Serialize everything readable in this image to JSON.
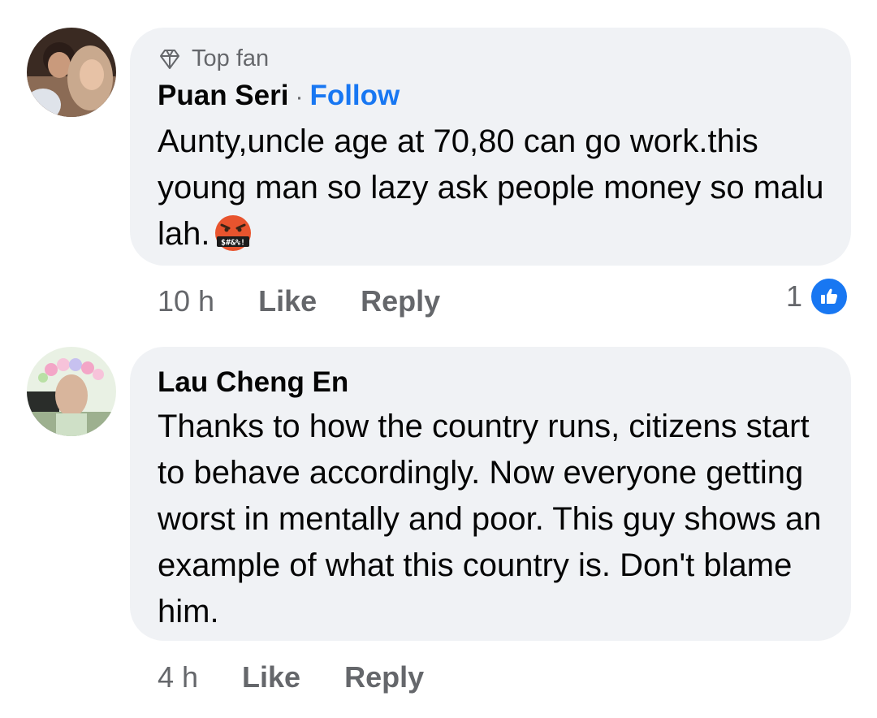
{
  "comments": [
    {
      "badge": "Top fan",
      "name": "Puan Seri",
      "separator": "·",
      "follow_label": "Follow",
      "text": "Aunty,uncle age at 70,80 can go work.this young man so lazy ask people money so malu lah.",
      "emoji": "face-with-symbols-on-mouth",
      "time": "10 h",
      "like_label": "Like",
      "reply_label": "Reply",
      "reaction_count": "1",
      "reaction_icon": "thumbs-up-icon"
    },
    {
      "name": "Lau Cheng En",
      "text": "Thanks to how the country runs, citizens start to behave accordingly. Now everyone getting worst in mentally and poor. This guy shows an example of what this country is. Don't blame him.",
      "time": "4 h",
      "like_label": "Like",
      "reply_label": "Reply"
    }
  ],
  "colors": {
    "bubble": "#f0f2f5",
    "link": "#1877f2",
    "muted": "#65676b",
    "text": "#050505"
  }
}
